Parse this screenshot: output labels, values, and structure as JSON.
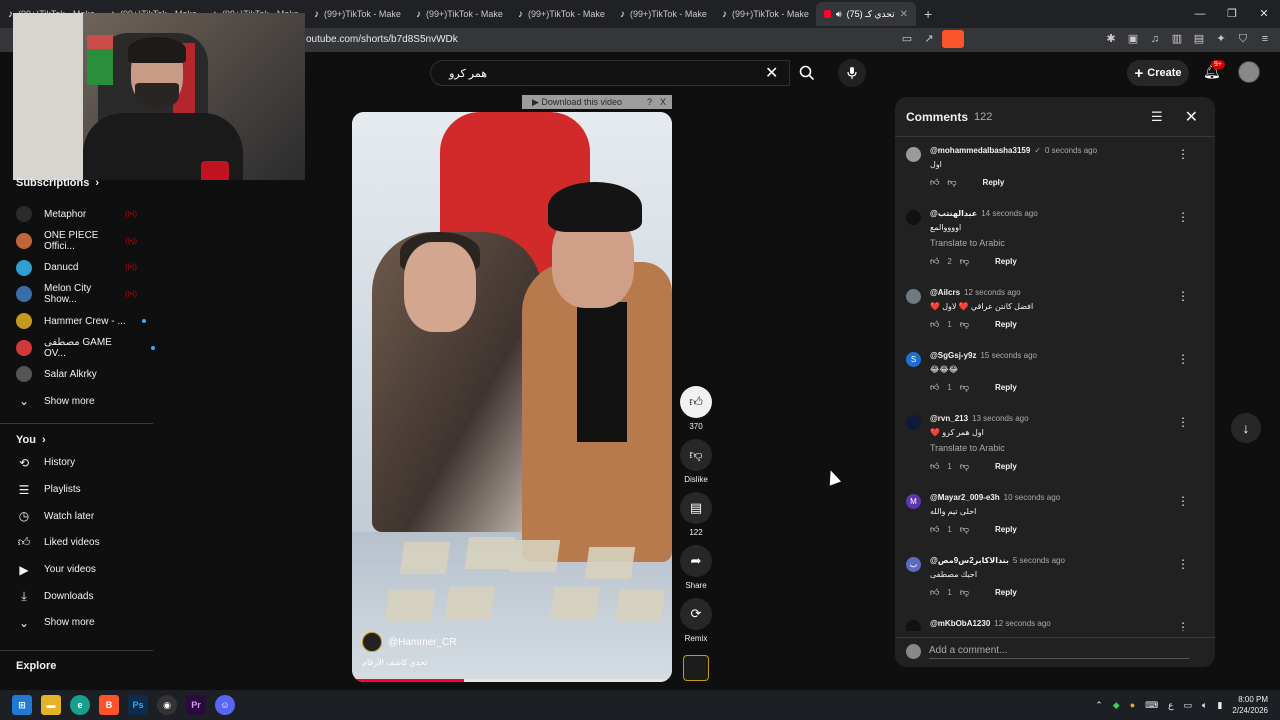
{
  "browser": {
    "tabs": [
      {
        "label": "(99+)TikTok - Make"
      },
      {
        "label": "(99+)TikTok - Make"
      },
      {
        "label": "(99+)TikTok - Make"
      },
      {
        "label": "(99+)TikTok - Make"
      },
      {
        "label": "(99+)TikTok - Make"
      },
      {
        "label": "(99+)TikTok - Make"
      },
      {
        "label": "(99+)TikTok - Make"
      },
      {
        "label": "(99+)TikTok - Make"
      }
    ],
    "active_tab": "(75) تحدي كـ",
    "url": "outube.com/shorts/b7d8S5nvWDk"
  },
  "header": {
    "search_value": "همر كرو",
    "create_label": "Create",
    "notif_count": "9+"
  },
  "download_bar": {
    "label": "▶ Download this video",
    "help": "?",
    "close": "X"
  },
  "sidebar": {
    "subscriptions_label": "Subscriptions",
    "channels": [
      {
        "name": "Metaphor",
        "color": "#2b2b2b",
        "status": "live"
      },
      {
        "name": "ONE PIECE Offici...",
        "color": "#c0673a",
        "status": "live"
      },
      {
        "name": "Danucd",
        "color": "#2f9fd1",
        "status": "live"
      },
      {
        "name": "Melon City Show...",
        "color": "#3a6ea8",
        "status": "live"
      },
      {
        "name": "Hammer Crew - ...",
        "color": "#c49a1e",
        "status": "new"
      },
      {
        "name": "مصطفى GAME OV...",
        "color": "#d23a3a",
        "status": "new"
      },
      {
        "name": "Salar Alkrky",
        "color": "#555555",
        "status": ""
      }
    ],
    "show_more_1": "Show more",
    "you_label": "You",
    "you_items": [
      {
        "label": "History",
        "icon": "history-icon"
      },
      {
        "label": "Playlists",
        "icon": "playlists-icon"
      },
      {
        "label": "Watch later",
        "icon": "clock-icon"
      },
      {
        "label": "Liked videos",
        "icon": "thumbs-up-icon"
      },
      {
        "label": "Your videos",
        "icon": "play-square-icon"
      },
      {
        "label": "Downloads",
        "icon": "download-icon"
      }
    ],
    "show_more_2": "Show more",
    "explore_label": "Explore"
  },
  "video": {
    "channel": "@Hammer_CR",
    "title": "تحدي كاشف الأرقام",
    "progress": 0.35
  },
  "actions": {
    "like_count": "370",
    "dislike_label": "Dislike",
    "comment_count": "122",
    "share_label": "Share",
    "remix_label": "Remix"
  },
  "comments": {
    "title": "Comments",
    "count": "122",
    "placeholder": "Add a comment...",
    "reply_label": "Reply",
    "items": [
      {
        "author": "@mohammedalbasha3159",
        "verified": "✓",
        "time": "0 seconds ago",
        "text": "اول",
        "likes": "",
        "translate": "",
        "avatar": "#9a9a9a",
        "initial": ""
      },
      {
        "author": "@عبدالهنتب",
        "verified": "",
        "time": "14 seconds ago",
        "text": "اووووالمع",
        "likes": "2",
        "translate": "Translate to Arabic",
        "avatar": "#111111",
        "initial": ""
      },
      {
        "author": "@Ailcrs",
        "verified": "",
        "time": "12 seconds ago",
        "text": "❤️ افضل كانتن عراقي ❤️ لاول",
        "likes": "1",
        "translate": "",
        "avatar": "#6d7a7f",
        "initial": ""
      },
      {
        "author": "@SgGsj-y9z",
        "verified": "",
        "time": "15 seconds ago",
        "text": "😂😂😂",
        "likes": "1",
        "translate": "",
        "avatar": "#1f6fd1",
        "initial": "S"
      },
      {
        "author": "@rvn_213",
        "verified": "",
        "time": "13 seconds ago",
        "text": "❤️ اول همر كرو",
        "likes": "1",
        "translate": "Translate to Arabic",
        "avatar": "#0d1a3a",
        "initial": ""
      },
      {
        "author": "@Mayar2_009-e3h",
        "verified": "",
        "time": "10 seconds ago",
        "text": "احلى تيم والله",
        "likes": "1",
        "translate": "",
        "avatar": "#5e35b1",
        "initial": "M"
      },
      {
        "author": "@بندالاكابر2س9مص",
        "verified": "",
        "time": "5 seconds ago",
        "text": "احبك مصطفى",
        "likes": "1",
        "translate": "",
        "avatar": "#5c6bc0",
        "initial": "ب"
      },
      {
        "author": "@mKbObA1230",
        "verified": "",
        "time": "12 seconds ago",
        "text": "",
        "likes": "",
        "translate": "",
        "avatar": "#111111",
        "initial": ""
      }
    ]
  },
  "taskbar": {
    "time": "8:00 PM",
    "date": "2/24/2026",
    "lang": "ع"
  }
}
